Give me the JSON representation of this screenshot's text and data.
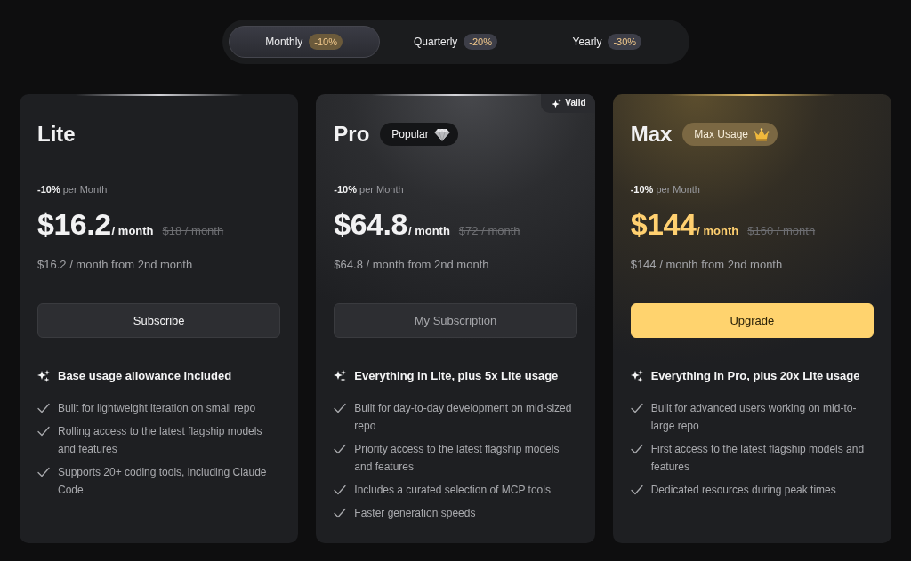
{
  "billing_tabs": [
    {
      "label": "Monthly",
      "discount": "-10%",
      "selected": true
    },
    {
      "label": "Quarterly",
      "discount": "-20%",
      "selected": false
    },
    {
      "label": "Yearly",
      "discount": "-30%",
      "selected": false
    }
  ],
  "plans": [
    {
      "name": "Lite",
      "kind": "plain",
      "discount_line": "**-10%** per Month",
      "price": "$16.2",
      "price_unit": "/ month",
      "original_price": "$18 / month",
      "renewal_note": "$16.2 / month from 2nd month",
      "button": {
        "label": "Subscribe",
        "kind": "secondary"
      },
      "highlight": "Base usage allowance included",
      "features": [
        "Built for lightweight iteration on small repo",
        "Rolling access to the latest flagship models and features",
        "Supports 20+ coding tools, including Claude Code"
      ]
    },
    {
      "name": "Pro",
      "kind": "silver",
      "badge": {
        "label": "Popular",
        "kind": "diamond"
      },
      "status_tag": "Valid",
      "discount_line": "**-10%** per Month",
      "price": "$64.8",
      "price_unit": "/ month",
      "original_price": "$72 / month",
      "renewal_note": "$64.8 / month from 2nd month",
      "button": {
        "label": "My Subscription",
        "kind": "current"
      },
      "highlight": "Everything in Lite, plus 5x Lite usage",
      "features": [
        "Built for day-to-day development on mid-sized repo",
        "Priority access to the latest flagship models and features",
        "Includes a curated selection of MCP tools",
        "Faster generation speeds"
      ]
    },
    {
      "name": "Max",
      "kind": "gold",
      "badge": {
        "label": "Max Usage",
        "kind": "crown"
      },
      "discount_line": "**-10%** per Month",
      "price": "$144",
      "price_unit": "/ month",
      "original_price": "$160 / month",
      "renewal_note": "$144 / month from 2nd month",
      "button": {
        "label": "Upgrade",
        "kind": "primary"
      },
      "highlight": "Everything in Pro, plus 20x Lite usage",
      "features": [
        "Built for advanced users working on mid-to-large repo",
        "First access to the latest flagship models and features",
        "Dedicated resources during peak times"
      ]
    }
  ]
}
